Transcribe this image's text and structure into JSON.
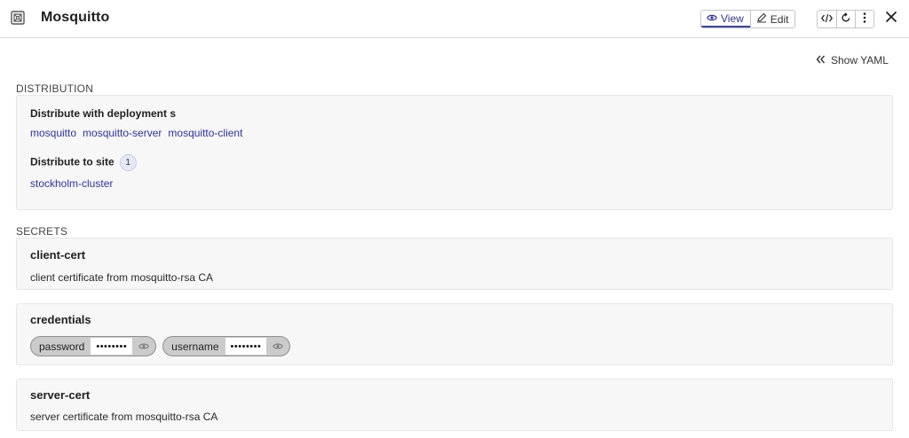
{
  "header": {
    "title": "Mosquitto",
    "app_icon": "safe-box-icon",
    "view_label": "View",
    "edit_label": "Edit",
    "tools": [
      "code-icon",
      "refresh-icon",
      "more-vertical-icon"
    ],
    "close_icon": "close-icon"
  },
  "toolbar": {
    "show_yaml_label": "Show YAML"
  },
  "distribution": {
    "section_label": "DISTRIBUTION",
    "deployments_label": "Distribute with deployment s",
    "deployments": [
      "mosquitto",
      "mosquitto-server",
      "mosquitto-client"
    ],
    "sites_label": "Distribute to site",
    "sites_count": "1",
    "sites": [
      "stockholm-cluster"
    ]
  },
  "secrets": {
    "section_label": "SECRETS",
    "items": [
      {
        "name": "client-cert",
        "description": "client certificate from mosquitto-rsa CA"
      },
      {
        "name": "credentials",
        "fields": [
          {
            "label": "password",
            "value": "••••••••"
          },
          {
            "label": "username",
            "value": "••••••••"
          }
        ]
      },
      {
        "name": "server-cert",
        "description": "server certificate from mosquitto-rsa CA"
      }
    ]
  },
  "colors": {
    "accent": "#2b34b3",
    "card_bg": "#f7f7f7",
    "chip_bg": "#cbcbcb"
  }
}
